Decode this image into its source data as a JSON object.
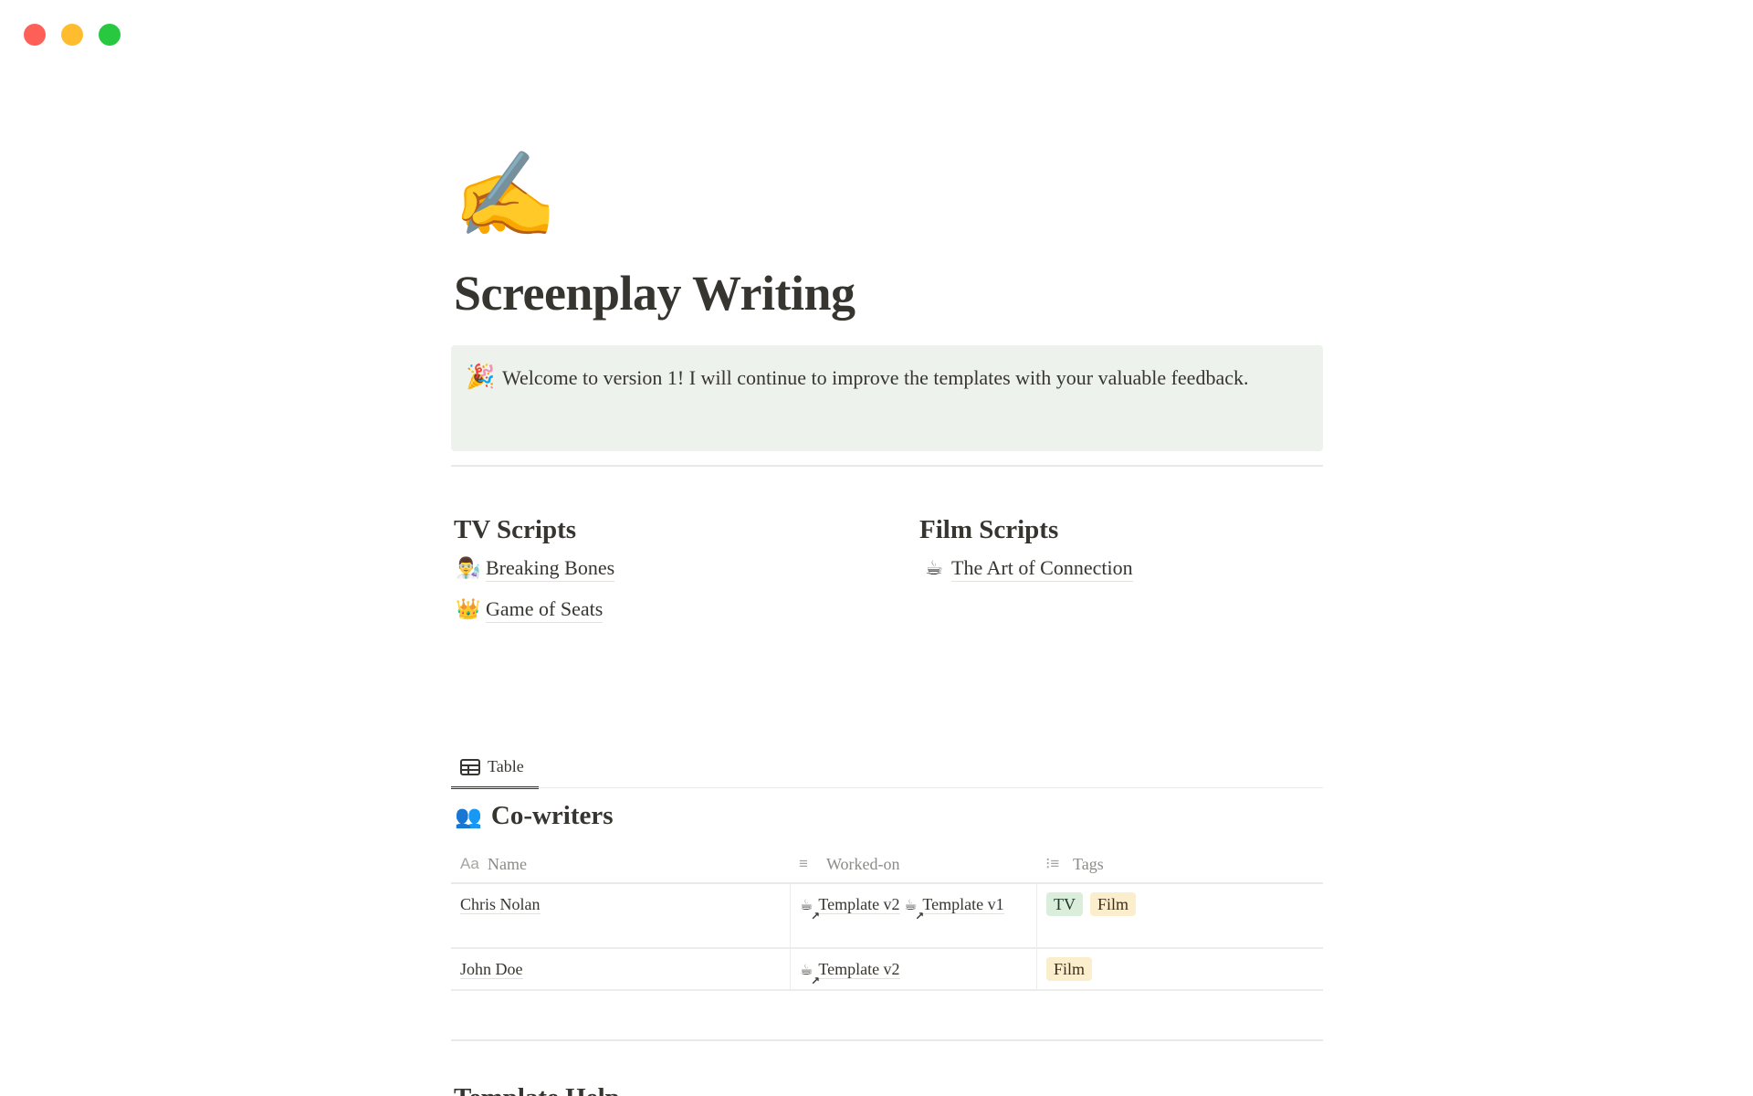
{
  "window": {
    "controls": [
      {
        "name": "close",
        "color": "#fe5f57"
      },
      {
        "name": "minimize",
        "color": "#febc2e"
      },
      {
        "name": "zoom",
        "color": "#28c840"
      }
    ]
  },
  "page": {
    "icon": "✍️",
    "title": "Screenplay Writing"
  },
  "callout": {
    "icon": "🎉",
    "text": "Welcome to version 1! I will continue to improve the templates with your valuable feedback."
  },
  "columns": [
    {
      "heading": "TV Scripts",
      "links": [
        {
          "icon": "👨‍🔬",
          "label": "Breaking Bones"
        },
        {
          "icon": "👑",
          "label": "Game of Seats"
        }
      ]
    },
    {
      "heading": "Film Scripts",
      "links": [
        {
          "icon": "☕",
          "label": "The Art of Connection"
        }
      ]
    }
  ],
  "database": {
    "view_tab": "Table",
    "icon": "👥",
    "title": "Co-writers",
    "columns": [
      {
        "icon": "Aa",
        "label": "Name"
      },
      {
        "icon": "≡",
        "label": "Worked-on"
      },
      {
        "icon": "⁝≡",
        "label": "Tags"
      }
    ],
    "rows": [
      {
        "name": "Chris Nolan",
        "worked_on": [
          {
            "icon": "☕",
            "label": "Template v2"
          },
          {
            "icon": "☕",
            "label": "Template v1"
          }
        ],
        "tags": [
          {
            "label": "TV",
            "bg": "#dbeddb",
            "fg": "#1c3829"
          },
          {
            "label": "Film",
            "bg": "#fbeecc",
            "fg": "#402c1b"
          }
        ]
      },
      {
        "name": "John Doe",
        "worked_on": [
          {
            "icon": "☕",
            "label": "Template v2"
          }
        ],
        "tags": [
          {
            "label": "Film",
            "bg": "#fbeecc",
            "fg": "#402c1b"
          }
        ]
      }
    ]
  },
  "next_section": {
    "heading": "Template Help"
  }
}
